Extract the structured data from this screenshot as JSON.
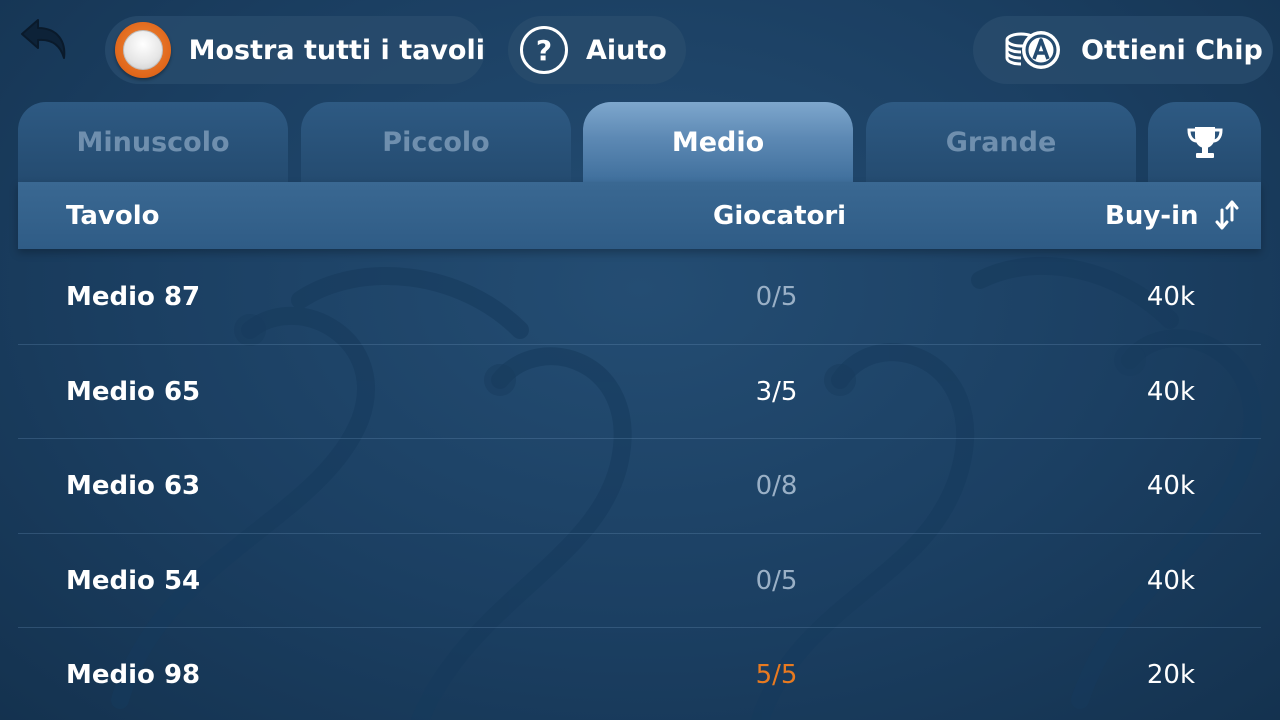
{
  "topbar": {
    "back_icon": "back-arrow-icon",
    "show_all_label": "Mostra tutti i tavoli",
    "help_label": "Aiuto",
    "help_glyph": "?",
    "chips_label": "Ottieni Chip"
  },
  "tabs": [
    {
      "label": "Minuscolo",
      "active": false
    },
    {
      "label": "Piccolo",
      "active": false
    },
    {
      "label": "Medio",
      "active": true
    },
    {
      "label": "Grande",
      "active": false
    }
  ],
  "trophy_tab_icon": "trophy-icon",
  "table": {
    "headers": {
      "name": "Tavolo",
      "players": "Giocatori",
      "buyin": "Buy-in"
    },
    "rows": [
      {
        "name": "Medio 87",
        "players": "0/5",
        "status": "empty",
        "buyin": "40k"
      },
      {
        "name": "Medio 65",
        "players": "3/5",
        "status": "partial",
        "buyin": "40k"
      },
      {
        "name": "Medio 63",
        "players": "0/8",
        "status": "empty",
        "buyin": "40k"
      },
      {
        "name": "Medio 54",
        "players": "0/5",
        "status": "empty",
        "buyin": "40k"
      },
      {
        "name": "Medio 98",
        "players": "5/5",
        "status": "full",
        "buyin": "20k"
      }
    ]
  },
  "colors": {
    "accent_orange": "#e87a20",
    "background": "#1b3f62",
    "muted_text": "#9ab0c6"
  }
}
